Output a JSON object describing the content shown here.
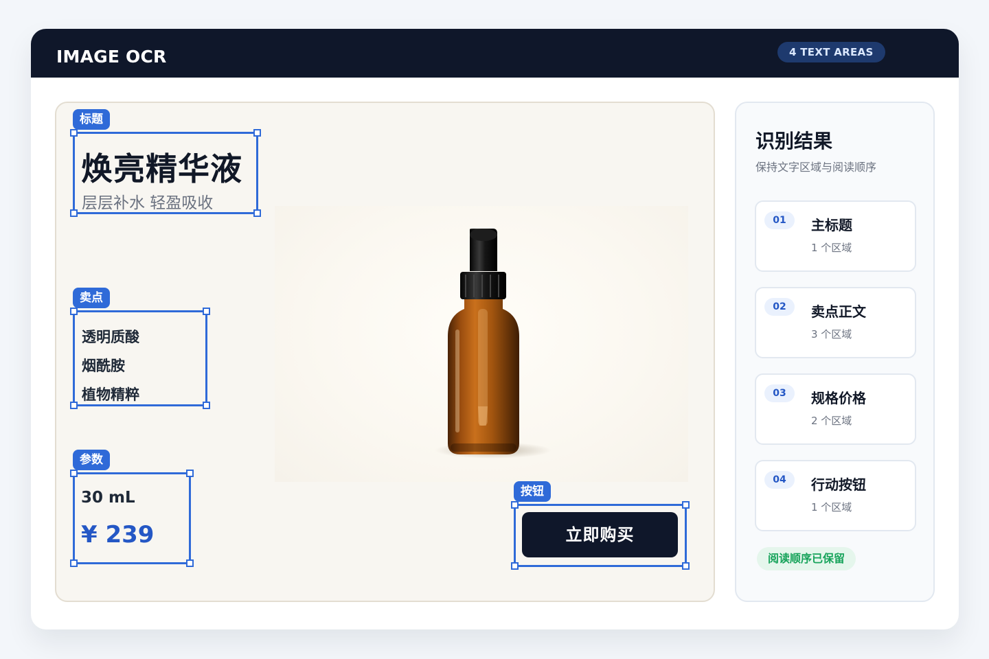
{
  "header": {
    "title": "IMAGE OCR",
    "badge": "4 TEXT AREAS"
  },
  "canvas": {
    "regions": {
      "title": {
        "tag": "标题",
        "heading": "焕亮精华液",
        "subheading": "层层补水  轻盈吸收"
      },
      "features": {
        "tag": "卖点",
        "items": [
          "透明质酸",
          "烟酰胺",
          "植物精粹"
        ]
      },
      "specs": {
        "tag": "参数",
        "volume": "30 mL",
        "price": "¥ 239"
      },
      "button": {
        "tag": "按钮",
        "label": "立即购买"
      }
    }
  },
  "results": {
    "title": "识别结果",
    "subtitle": "保持文字区域与阅读顺序",
    "cards": [
      {
        "num": "01",
        "title": "主标题",
        "sub": "1 个区域"
      },
      {
        "num": "02",
        "title": "卖点正文",
        "sub": "3 个区域"
      },
      {
        "num": "03",
        "title": "规格价格",
        "sub": "2 个区域"
      },
      {
        "num": "04",
        "title": "行动按钮",
        "sub": "1 个区域"
      }
    ],
    "status": "阅读顺序已保留"
  },
  "colors": {
    "accent": "#2f6ad8",
    "header_bg": "#0f172a",
    "price": "#2457c5",
    "success": "#16a35a"
  }
}
